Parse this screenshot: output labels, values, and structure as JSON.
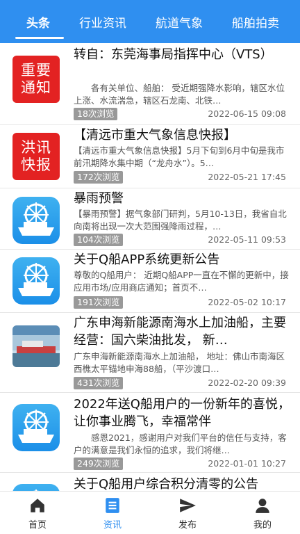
{
  "tabs": [
    {
      "label": "头条",
      "active": true
    },
    {
      "label": "行业资讯"
    },
    {
      "label": "航道气象"
    },
    {
      "label": "船舶拍卖"
    }
  ],
  "articles": [
    {
      "thumb": "red-badge-icon",
      "thumb_text": [
        "重要",
        "通知"
      ],
      "title": "转自：东莞海事局指挥中心（VTS）",
      "summary": "各有关单位、船舶：    受近期强降水影响，辖区水位上涨、水流湍急，辖区石龙南、北铁…",
      "views": "18次浏览",
      "date": "2022-06-15 09:08"
    },
    {
      "thumb": "red-badge-icon",
      "thumb_text": [
        "洪讯",
        "快报"
      ],
      "title": "【清远市重大气象信息快报】",
      "summary": "【清远市重大气象信息快报】5月下旬到6月中旬是我市前汛期降水集中期（“龙舟水”）。5…",
      "views": "172次浏览",
      "date": "2022-05-21 17:45"
    },
    {
      "thumb": "ship-app-icon",
      "title": "暴雨预警",
      "summary": "【暴雨预警】据气象部门研判，5月10-13日，我省自北向南将出现一次大范围强降雨过程，…",
      "views": "104次浏览",
      "date": "2022-05-11 09:53"
    },
    {
      "thumb": "ship-app-icon",
      "title": "关于Q船APP系统更新公告",
      "summary": "尊敬的Q船用户：    近期Q船APP一直在不懈的更新中，接应用市场/应用商店通知；首页不…",
      "views": "191次浏览",
      "date": "2022-05-02 10:17"
    },
    {
      "thumb": "fuel-barge-photo",
      "title": "广东申海新能源南海水上加油船，主要经营：国六柴油批发，  新…",
      "summary": "广东申海新能源南海水上加油船，  地址：佛山市南海区西樵太平锚地申海88船，（平沙渡口…",
      "views": "431次浏览",
      "date": "2022-02-20 09:39"
    },
    {
      "thumb": "ship-app-icon",
      "title": "2022年送Q船用户的一份新年的喜悦，让你事业腾飞，幸福常伴",
      "summary": "感恩2021，感谢用户对我们平台的信任与支持，客户的满意是我们永恒的追求，我们将继…",
      "views": "249次浏览",
      "date": "2022-01-01 10:27"
    },
    {
      "thumb": "ship-app-icon",
      "title": "关于Q船用户综合积分清零的公告",
      "summary": "",
      "views": "",
      "date": ""
    }
  ],
  "nav": [
    {
      "label": "首页",
      "icon": "home-icon"
    },
    {
      "label": "资讯",
      "icon": "news-icon",
      "active": true
    },
    {
      "label": "发布",
      "icon": "send-icon"
    },
    {
      "label": "我的",
      "icon": "user-icon"
    }
  ],
  "colors": {
    "accent": "#2f8ff0",
    "badge_red": "#e32222",
    "views_bg": "#999999"
  }
}
